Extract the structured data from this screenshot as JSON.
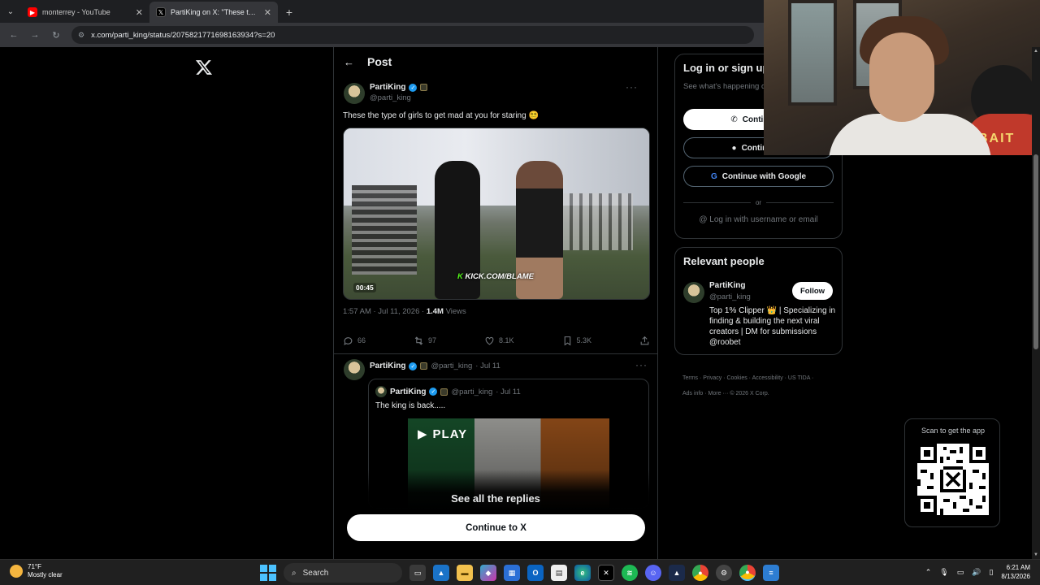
{
  "browser": {
    "tabs": [
      {
        "title": "monterrey - YouTube",
        "active": false,
        "favicon": "youtube-icon"
      },
      {
        "title": "PartiKing on X: \"These the type",
        "active": true,
        "favicon": "x-icon"
      }
    ],
    "url": "x.com/parti_king/status/2075821771698163934?s=20"
  },
  "post": {
    "header": "Post",
    "author": {
      "name": "PartiKing",
      "handle": "@parti_king"
    },
    "text": "These the type of girls to get mad at you for staring 😵‍💫",
    "media": {
      "duration": "00:45",
      "overlay_prefix": "K",
      "overlay_text": "KICK.COM/BLAME"
    },
    "meta": {
      "time": "1:57 AM · Jul 11, 2026 · ",
      "views_count": "1.4M",
      "views_label": " Views"
    },
    "actions": {
      "replies": "66",
      "reposts": "97",
      "likes": "8.1K",
      "bookmarks": "5.3K"
    }
  },
  "reply": {
    "name": "PartiKing",
    "handle": "@parti_king",
    "date": "· Jul 11",
    "quote": {
      "name": "PartiKing",
      "handle": "@parti_king",
      "date": "· Jul 11",
      "text": "The king is back.....",
      "media_label": "PLAY"
    }
  },
  "overlay": {
    "see_all": "See all the replies",
    "continue": "Continue to X"
  },
  "login": {
    "title": "Log in or sign up",
    "subtitle": "See what’s happening conversation",
    "phone_btn": "Continue w",
    "apple_btn": "Continue w",
    "google_btn": "Continue with Google",
    "or": "or",
    "username_link": "Log in with username or email"
  },
  "relevant": {
    "title": "Relevant people",
    "name": "PartiKing",
    "handle": "@parti_king",
    "follow": "Follow",
    "bio": "Top 1% Clipper 👑 | Specializing in finding & building the next viral creators | DM for submissions @roobet"
  },
  "footer": {
    "line1": "Terms · Privacy · Cookies · Accessibility · US TIDA ·",
    "line2": "Ads info · More ··· © 2026 X Corp."
  },
  "qr": {
    "label": "Scan to get the app"
  },
  "webcam": {
    "chair_text": "BAIT"
  },
  "taskbar": {
    "weather_temp": "71°F",
    "weather_desc": "Mostly clear",
    "search": "Search",
    "time": "6:21 AM",
    "date": "8/13/2026"
  }
}
